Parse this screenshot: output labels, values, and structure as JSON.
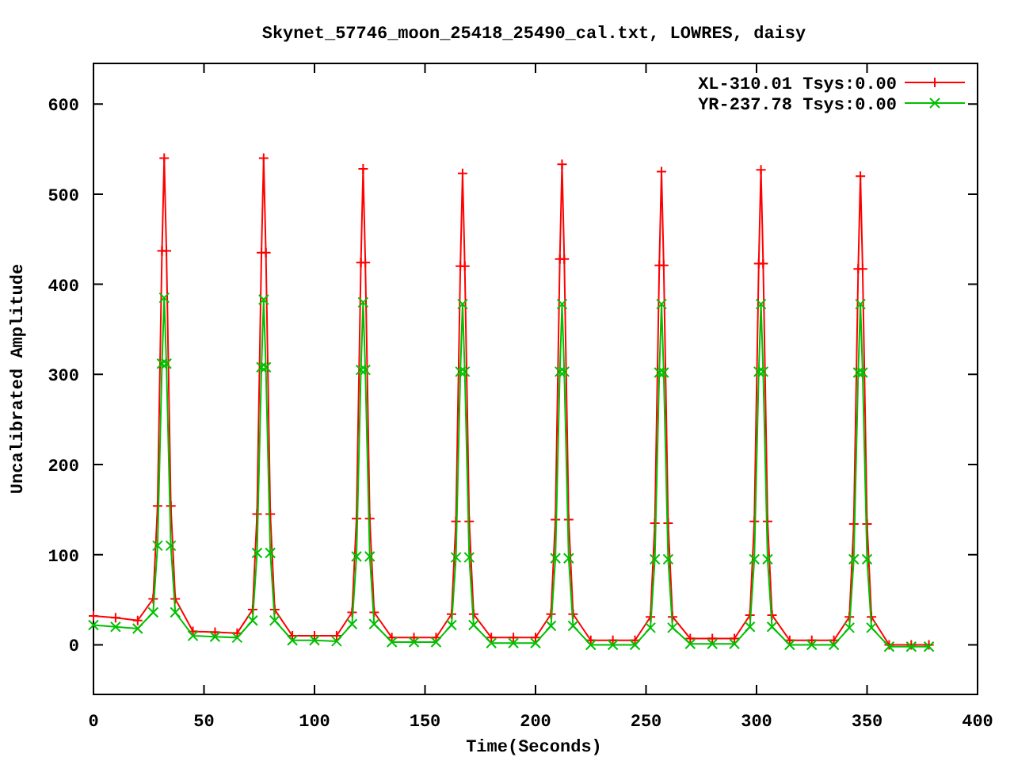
{
  "chart": {
    "chart_data": {
      "type": "line",
      "title": "Skynet_57746_moon_25418_25490_cal.txt, LOWRES, daisy",
      "xlabel": "Time(Seconds)",
      "ylabel": "Uncalibrated Amplitude",
      "x": [
        0,
        10,
        20,
        27,
        29,
        31,
        32,
        33,
        35,
        37,
        45,
        55,
        65,
        72,
        74,
        76,
        77,
        78,
        80,
        82,
        90,
        100,
        110,
        117,
        119,
        121,
        122,
        123,
        125,
        127,
        135,
        145,
        155,
        162,
        164,
        166,
        167,
        168,
        170,
        172,
        180,
        190,
        200,
        207,
        209,
        211,
        212,
        213,
        215,
        217,
        225,
        235,
        245,
        252,
        254,
        256,
        257,
        258,
        260,
        262,
        270,
        280,
        290,
        297,
        299,
        301,
        302,
        303,
        305,
        307,
        315,
        325,
        335,
        342,
        344,
        346,
        347,
        348,
        350,
        352,
        360,
        370,
        378
      ],
      "series": [
        {
          "name": "XL-310.01 Tsys:0.00",
          "color": "#ff0000",
          "marker": "plus",
          "values": [
            32,
            30,
            27,
            51,
            154,
            437,
            540,
            437,
            154,
            51,
            15,
            14,
            13,
            39,
            145,
            435,
            540,
            435,
            145,
            39,
            10,
            10,
            10,
            36,
            140,
            424,
            528,
            424,
            140,
            36,
            8,
            8,
            8,
            34,
            137,
            420,
            523,
            420,
            137,
            34,
            8,
            8,
            8,
            34,
            139,
            428,
            533,
            428,
            139,
            34,
            5,
            5,
            5,
            31,
            135,
            421,
            525,
            421,
            135,
            31,
            7,
            7,
            7,
            33,
            137,
            423,
            527,
            423,
            137,
            33,
            5,
            5,
            5,
            31,
            134,
            417,
            520,
            417,
            134,
            31,
            0,
            0,
            0
          ]
        },
        {
          "name": "YR-237.78 Tsys:0.00",
          "color": "#00c000",
          "marker": "cross",
          "values": [
            22,
            20,
            18,
            36,
            110,
            312,
            385,
            312,
            110,
            36,
            10,
            9,
            8,
            27,
            102,
            308,
            383,
            308,
            102,
            27,
            5,
            5,
            4,
            23,
            98,
            305,
            380,
            305,
            98,
            23,
            3,
            3,
            3,
            22,
            97,
            303,
            378,
            303,
            97,
            22,
            2,
            2,
            2,
            21,
            96,
            303,
            378,
            303,
            96,
            21,
            0,
            0,
            0,
            19,
            95,
            302,
            378,
            302,
            95,
            19,
            1,
            1,
            1,
            20,
            95,
            303,
            378,
            303,
            95,
            20,
            0,
            0,
            0,
            19,
            95,
            302,
            378,
            302,
            95,
            19,
            -2,
            -2,
            -2
          ]
        }
      ],
      "legend": true,
      "xlim": [
        0,
        400
      ],
      "ylim": [
        -55,
        645
      ],
      "xticks": [
        0,
        50,
        100,
        150,
        200,
        250,
        300,
        350,
        400
      ],
      "yticks": [
        0,
        100,
        200,
        300,
        400,
        500,
        600
      ]
    }
  }
}
